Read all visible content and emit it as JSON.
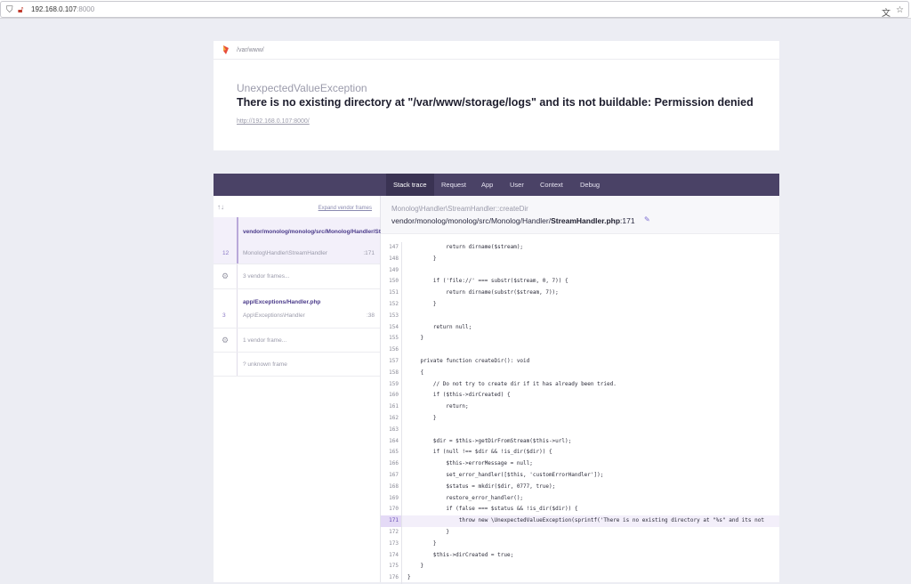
{
  "browser": {
    "url_host": "192.168.0.107",
    "url_port": ":8000"
  },
  "header": {
    "path": "/var/www/",
    "exception_class": "UnexpectedValueException",
    "message": "There is no existing directory at \"/var/www/storage/logs\" and its not buildable: Permission denied",
    "url": "http://192.168.0.107:8000/"
  },
  "tabs": [
    {
      "label": "Stack trace",
      "active": true
    },
    {
      "label": "Request"
    },
    {
      "label": "App"
    },
    {
      "label": "User"
    },
    {
      "label": "Context"
    },
    {
      "label": "Debug"
    }
  ],
  "frames_panel": {
    "expand_label": "Expand vendor frames",
    "frames": [
      {
        "file": "vendor/monolog/monolog/src/Monolog/Handler/StreamHandler.php",
        "class": "Monolog\\Handler\\StreamHandler",
        "number": "12",
        "line": ":171"
      },
      {
        "collapsed": "3 vendor frames..."
      },
      {
        "file": "app/Exceptions/Handler.php",
        "class": "App\\Exceptions\\Handler",
        "number": "3",
        "line": ":38"
      },
      {
        "collapsed": "1 vendor frame..."
      },
      {
        "collapsed": "? unknown frame"
      }
    ]
  },
  "code": {
    "class_method": "Monolog\\Handler\\StreamHandler::createDir",
    "file_prefix": "vendor/monolog/monolog/src/Monolog/Handler/",
    "file_name": "StreamHandler.php",
    "file_suffix": ":171",
    "highlight_line": "171",
    "lines": [
      {
        "n": "147",
        "t": "            return dirname($stream);"
      },
      {
        "n": "148",
        "t": "        }"
      },
      {
        "n": "149",
        "t": ""
      },
      {
        "n": "150",
        "t": "        if ('file://' === substr($stream, 0, 7)) {"
      },
      {
        "n": "151",
        "t": "            return dirname(substr($stream, 7));"
      },
      {
        "n": "152",
        "t": "        }"
      },
      {
        "n": "153",
        "t": ""
      },
      {
        "n": "154",
        "t": "        return null;"
      },
      {
        "n": "155",
        "t": "    }"
      },
      {
        "n": "156",
        "t": ""
      },
      {
        "n": "157",
        "t": "    private function createDir(): void"
      },
      {
        "n": "158",
        "t": "    {"
      },
      {
        "n": "159",
        "t": "        // Do not try to create dir if it has already been tried."
      },
      {
        "n": "160",
        "t": "        if ($this->dirCreated) {"
      },
      {
        "n": "161",
        "t": "            return;"
      },
      {
        "n": "162",
        "t": "        }"
      },
      {
        "n": "163",
        "t": ""
      },
      {
        "n": "164",
        "t": "        $dir = $this->getDirFromStream($this->url);"
      },
      {
        "n": "165",
        "t": "        if (null !== $dir && !is_dir($dir)) {"
      },
      {
        "n": "166",
        "t": "            $this->errorMessage = null;"
      },
      {
        "n": "167",
        "t": "            set_error_handler([$this, 'customErrorHandler']);"
      },
      {
        "n": "168",
        "t": "            $status = mkdir($dir, 0777, true);"
      },
      {
        "n": "169",
        "t": "            restore_error_handler();"
      },
      {
        "n": "170",
        "t": "            if (false === $status && !is_dir($dir)) {"
      },
      {
        "n": "171",
        "t": "                throw new \\UnexpectedValueException(sprintf('There is no existing directory at \"%s\" and its not"
      },
      {
        "n": "172",
        "t": "            }"
      },
      {
        "n": "173",
        "t": "        }"
      },
      {
        "n": "174",
        "t": "        $this->dirCreated = true;"
      },
      {
        "n": "175",
        "t": "    }"
      },
      {
        "n": "176",
        "t": "}"
      }
    ]
  }
}
